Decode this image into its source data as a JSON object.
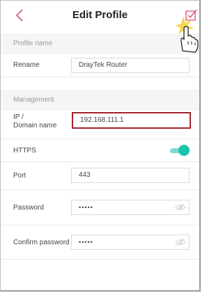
{
  "header": {
    "title": "Edit Profile",
    "back_icon": "chevron-left-icon",
    "save_icon": "checkbox-check-icon"
  },
  "sections": {
    "profile": {
      "label": "Profile name"
    },
    "management": {
      "label": "Management"
    }
  },
  "fields": {
    "rename": {
      "label": "Rename",
      "value": "DrayTek Router"
    },
    "ip": {
      "label_line1": "IP /",
      "label_line2": "Domain name",
      "value": "192.168.111.1"
    },
    "https": {
      "label": "HTTPS",
      "enabled": true
    },
    "port": {
      "label": "Port",
      "value": "443"
    },
    "password": {
      "label": "Password",
      "value": "•••••"
    },
    "confirm_password": {
      "label": "Confirm password",
      "value": "•••••"
    }
  },
  "colors": {
    "accent": "#d9536e",
    "highlight_border": "#a5232b",
    "toggle_on": "#1cc3ad"
  }
}
